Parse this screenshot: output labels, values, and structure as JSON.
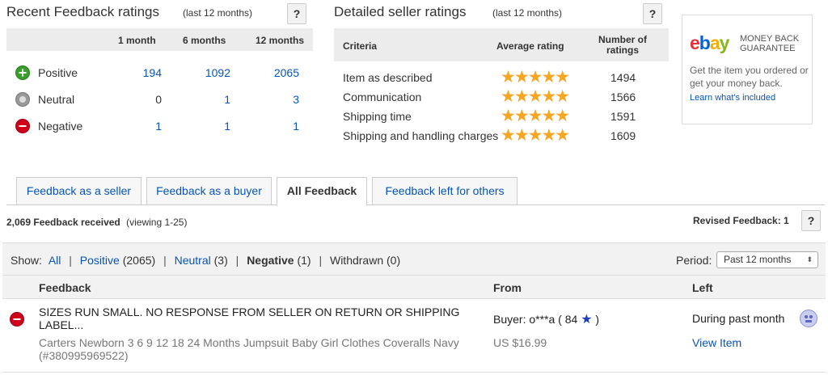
{
  "recent": {
    "title": "Recent Feedback ratings",
    "subtitle": "(last 12 months)",
    "help": "?",
    "cols": [
      "1 month",
      "6 months",
      "12 months"
    ],
    "rows": [
      {
        "label": "Positive",
        "v1": "194",
        "v6": "1092",
        "v12": "2065"
      },
      {
        "label": "Neutral",
        "v1": "0",
        "v6": "1",
        "v12": "3"
      },
      {
        "label": "Negative",
        "v1": "1",
        "v6": "1",
        "v12": "1"
      }
    ]
  },
  "detailed": {
    "title": "Detailed seller ratings",
    "subtitle": "(last 12 months)",
    "help": "?",
    "col_criteria": "Criteria",
    "col_avg": "Average rating",
    "col_num": "Number of ratings",
    "rows": [
      {
        "label": "Item as described",
        "stars": 5,
        "count": "1494"
      },
      {
        "label": "Communication",
        "stars": 5,
        "count": "1566"
      },
      {
        "label": "Shipping time",
        "stars": 5,
        "count": "1591"
      },
      {
        "label": "Shipping and handling charges",
        "stars": 5,
        "count": "1609"
      }
    ]
  },
  "guarantee": {
    "logo": "ebay",
    "badge_line1": "MONEY BACK",
    "badge_line2": "GUARANTEE",
    "text": "Get the item you ordered or get your money back.",
    "link": "Learn what's included"
  },
  "tabs": [
    "Feedback as a seller",
    "Feedback as a buyer",
    "All Feedback",
    "Feedback left for others"
  ],
  "summary": {
    "count": "2,069 Feedback received",
    "viewing": "(viewing 1-25)",
    "revised": "Revised Feedback: 1",
    "help": "?"
  },
  "filters": {
    "show": "Show:",
    "all": "All",
    "positive": "Positive",
    "positive_count": "(2065)",
    "neutral": "Neutral",
    "neutral_count": "(3)",
    "negative": "Negative",
    "negative_count": "(1)",
    "withdrawn": "Withdrawn",
    "withdrawn_count": "(0)",
    "period_label": "Period:",
    "period_value": "Past 12 months"
  },
  "table": {
    "headers": {
      "feedback": "Feedback",
      "from": "From",
      "left": "Left"
    },
    "row": {
      "comment": "SIZES RUN SMALL. NO RESPONSE FROM SELLER ON RETURN OR SHIPPING LABEL...",
      "from": "Buyer: o***a ( 84",
      "from_close": ")",
      "left": "During past month",
      "item": "Carters Newborn 3 6 9 12 18 24 Months Jumpsuit Baby Girl Clothes Coveralls Navy (#380995969522)",
      "price": "US $16.99",
      "view": "View Item"
    }
  },
  "colors": {
    "link": "#0654ba",
    "star": "#f5a623",
    "positive": "#3a9e2a",
    "negative": "#d0021b",
    "neutral": "#888888"
  }
}
